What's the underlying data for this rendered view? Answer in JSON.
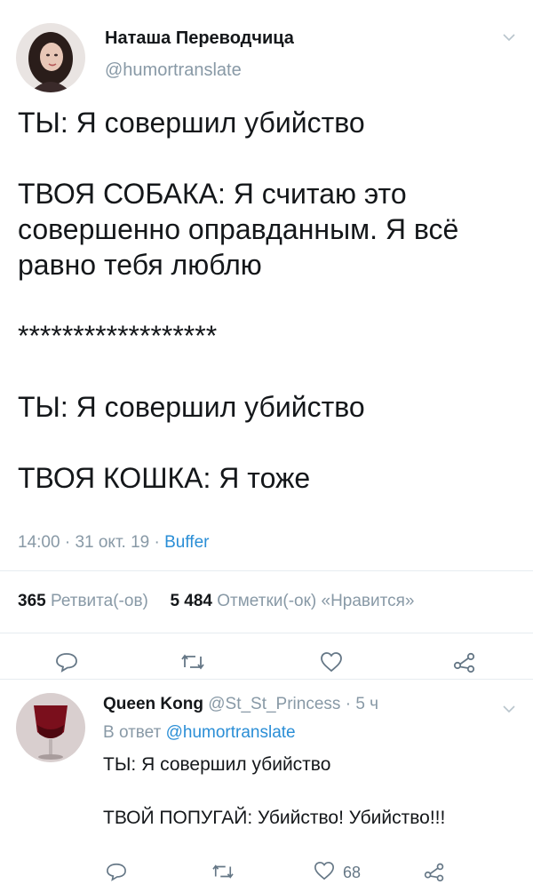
{
  "tweet": {
    "author_name": "Наташа Переводчица",
    "author_handle": "@humortranslate",
    "lines": [
      "ТЫ: Я совершил убийство",
      "",
      "ТВОЯ СОБАКА: Я считаю это",
      "совершенно оправданным. Я всё",
      "равно тебя люблю",
      "",
      "******************",
      "",
      "ТЫ: Я совершил убийство",
      "",
      "ТВОЯ КОШКА: Я тоже"
    ],
    "time": "14:00",
    "date": "31 окт. 19",
    "source": "Buffer",
    "retweets_count": "365",
    "retweets_label": "Ретвита(-ов)",
    "likes_count": "5 484",
    "likes_label": "Отметки(-ок) «Нравится»"
  },
  "reply": {
    "author_name": "Queen Kong",
    "author_handle": "@St_St_Princess",
    "age": "5 ч",
    "reply_to_label": "В ответ",
    "reply_to_handle": "@humortranslate",
    "line1": "ТЫ: Я совершил убийство",
    "line2": "ТВОЙ ПОПУГАЙ: Убийство! Убийство!!!",
    "likes": "68"
  },
  "colors": {
    "link": "#2a8ed6",
    "muted": "#8899a6",
    "divider": "#e6ecf0"
  },
  "icons": [
    "reply-icon",
    "retweet-icon",
    "like-icon",
    "share-icon",
    "chevron-down-icon"
  ]
}
